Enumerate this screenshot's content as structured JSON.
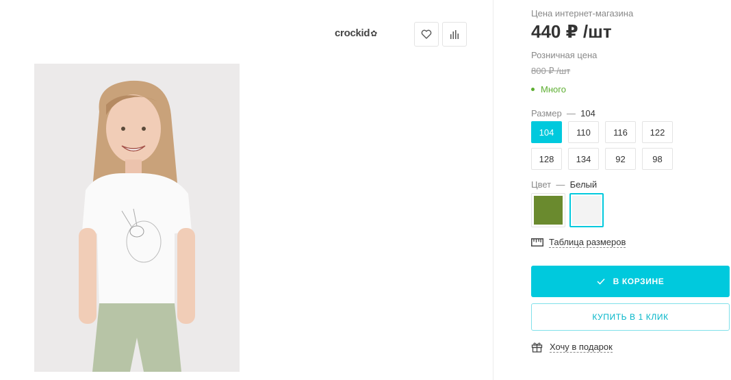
{
  "brand": {
    "name": "crockid",
    "mark": "✿"
  },
  "gallery": {
    "favorite_icon": "heart-icon",
    "compare_icon": "bar-chart-icon"
  },
  "product": {
    "price_online_label": "Цена интернет-магазина",
    "price_online": "440 ₽ /шт",
    "price_retail_label": "Розничная цена",
    "price_retail": "800 ₽ /шт",
    "stock_text": "Много",
    "stock_color": "#5cae30"
  },
  "size": {
    "label": "Размер",
    "dash": "—",
    "selected": "104",
    "options": [
      "104",
      "110",
      "116",
      "122",
      "128",
      "134",
      "92",
      "98"
    ]
  },
  "color": {
    "label": "Цвет",
    "dash": "—",
    "selected": "Белый",
    "swatches": [
      {
        "name": "olive",
        "hex": "#6a8a2e"
      },
      {
        "name": "white",
        "hex": "#f3f3f3"
      }
    ]
  },
  "size_table": {
    "label": "Таблица размеров",
    "icon": "ruler-icon"
  },
  "cart": {
    "label": "В КОРЗИНЕ",
    "icon": "check-icon"
  },
  "one_click": {
    "label": "КУПИТЬ В 1 КЛИК"
  },
  "gift": {
    "label": "Хочу в подарок",
    "icon": "gift-icon"
  },
  "accent_color": "#00c9dd"
}
